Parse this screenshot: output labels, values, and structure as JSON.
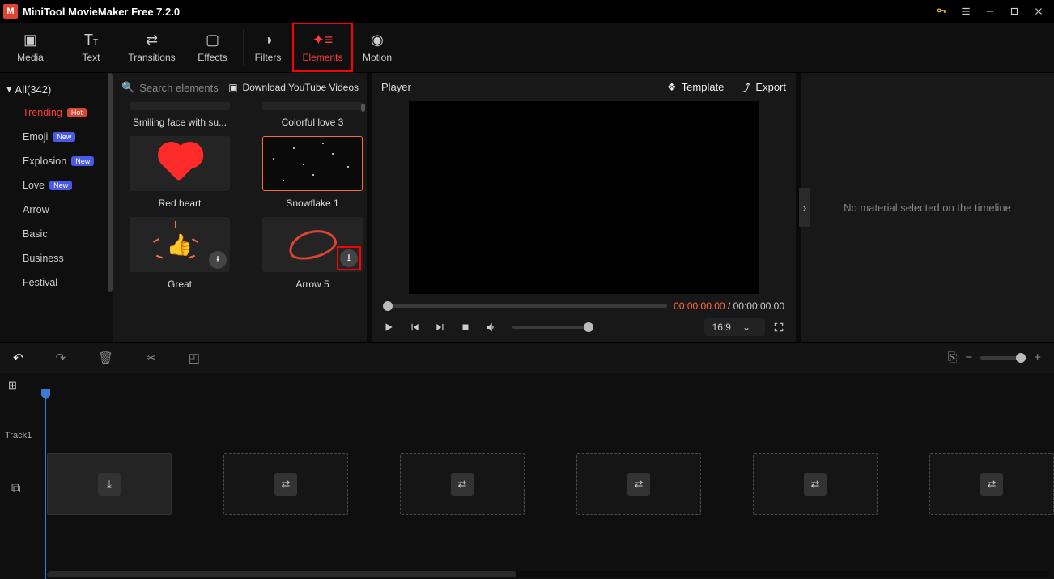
{
  "app": {
    "title": "MiniTool MovieMaker Free 7.2.0"
  },
  "toolbar": {
    "media": "Media",
    "text": "Text",
    "transitions": "Transitions",
    "effects": "Effects",
    "filters": "Filters",
    "elements": "Elements",
    "motion": "Motion"
  },
  "sidebar": {
    "all_label": "All(342)",
    "cats": [
      {
        "label": "Trending",
        "badge": "Hot",
        "badge_kind": "hot",
        "active": true
      },
      {
        "label": "Emoji",
        "badge": "New",
        "badge_kind": "new"
      },
      {
        "label": "Explosion",
        "badge": "New",
        "badge_kind": "new"
      },
      {
        "label": "Love",
        "badge": "New",
        "badge_kind": "new"
      },
      {
        "label": "Arrow"
      },
      {
        "label": "Basic"
      },
      {
        "label": "Business"
      },
      {
        "label": "Festival"
      }
    ]
  },
  "elements_panel": {
    "search_placeholder": "Search elements",
    "download_link": "Download YouTube Videos",
    "items": {
      "r0a": "Smiling face with su...",
      "r0b": "Colorful love 3",
      "r1a": "Red heart",
      "r1b": "Snowflake 1",
      "r2a": "Great",
      "r2b": "Arrow 5"
    }
  },
  "player": {
    "title": "Player",
    "template": "Template",
    "export": "Export",
    "tc_current": "00:00:00.00",
    "tc_sep": " / ",
    "tc_total": "00:00:00.00",
    "ratio": "16:9"
  },
  "inspector": {
    "empty": "No material selected on the timeline"
  },
  "timeline": {
    "track1": "Track1"
  }
}
